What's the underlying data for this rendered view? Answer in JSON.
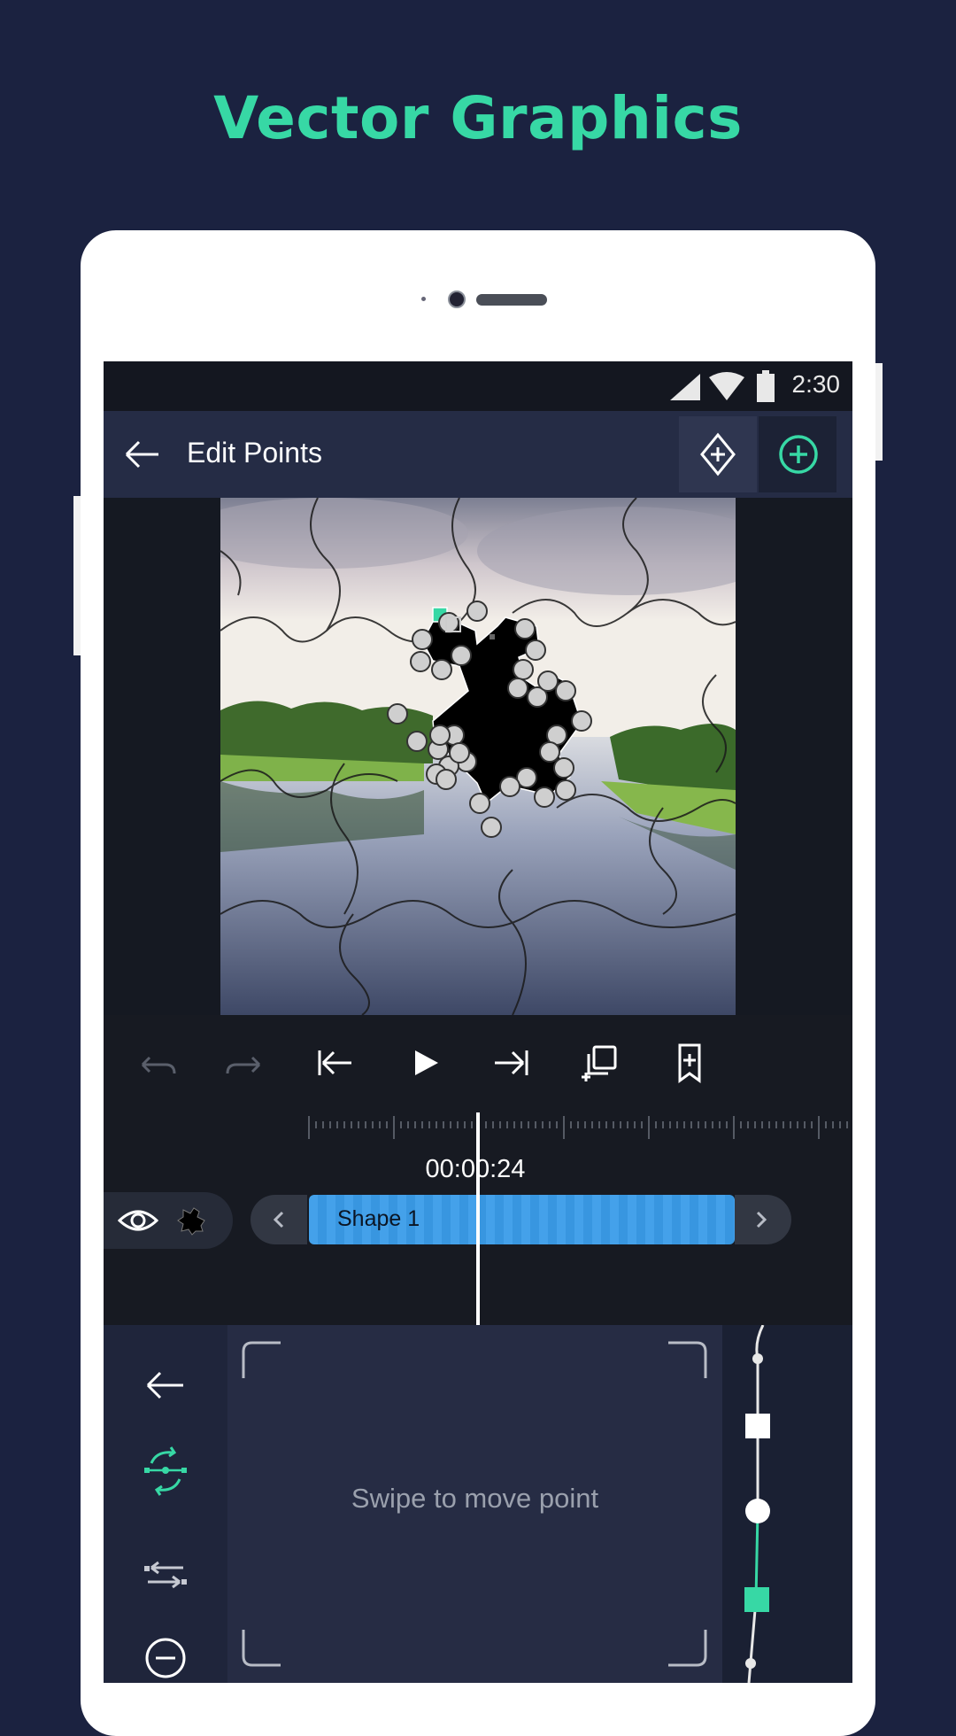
{
  "promo": {
    "title": "Vector Graphics"
  },
  "status_bar": {
    "time": "2:30"
  },
  "app_bar": {
    "title": "Edit Points"
  },
  "timeline": {
    "timecode": "00:00:24",
    "layer_label": "Shape 1"
  },
  "edit_pad": {
    "hint": "Swipe to move point"
  },
  "colors": {
    "accent": "#37d8a5",
    "track": "#3a9ce9",
    "background": "#1b2240"
  },
  "icons": {
    "app_bar": [
      "back-arrow-icon",
      "add-keyframe-icon",
      "add-point-icon"
    ],
    "toolbar": [
      "undo-icon",
      "redo-icon",
      "jump-to-start-icon",
      "play-icon",
      "jump-to-end-icon",
      "duplicate-icon",
      "bookmark-add-icon"
    ],
    "side_tools": [
      "back-arrow-icon",
      "rotate-point-icon",
      "swap-icon",
      "remove-point-icon"
    ]
  }
}
